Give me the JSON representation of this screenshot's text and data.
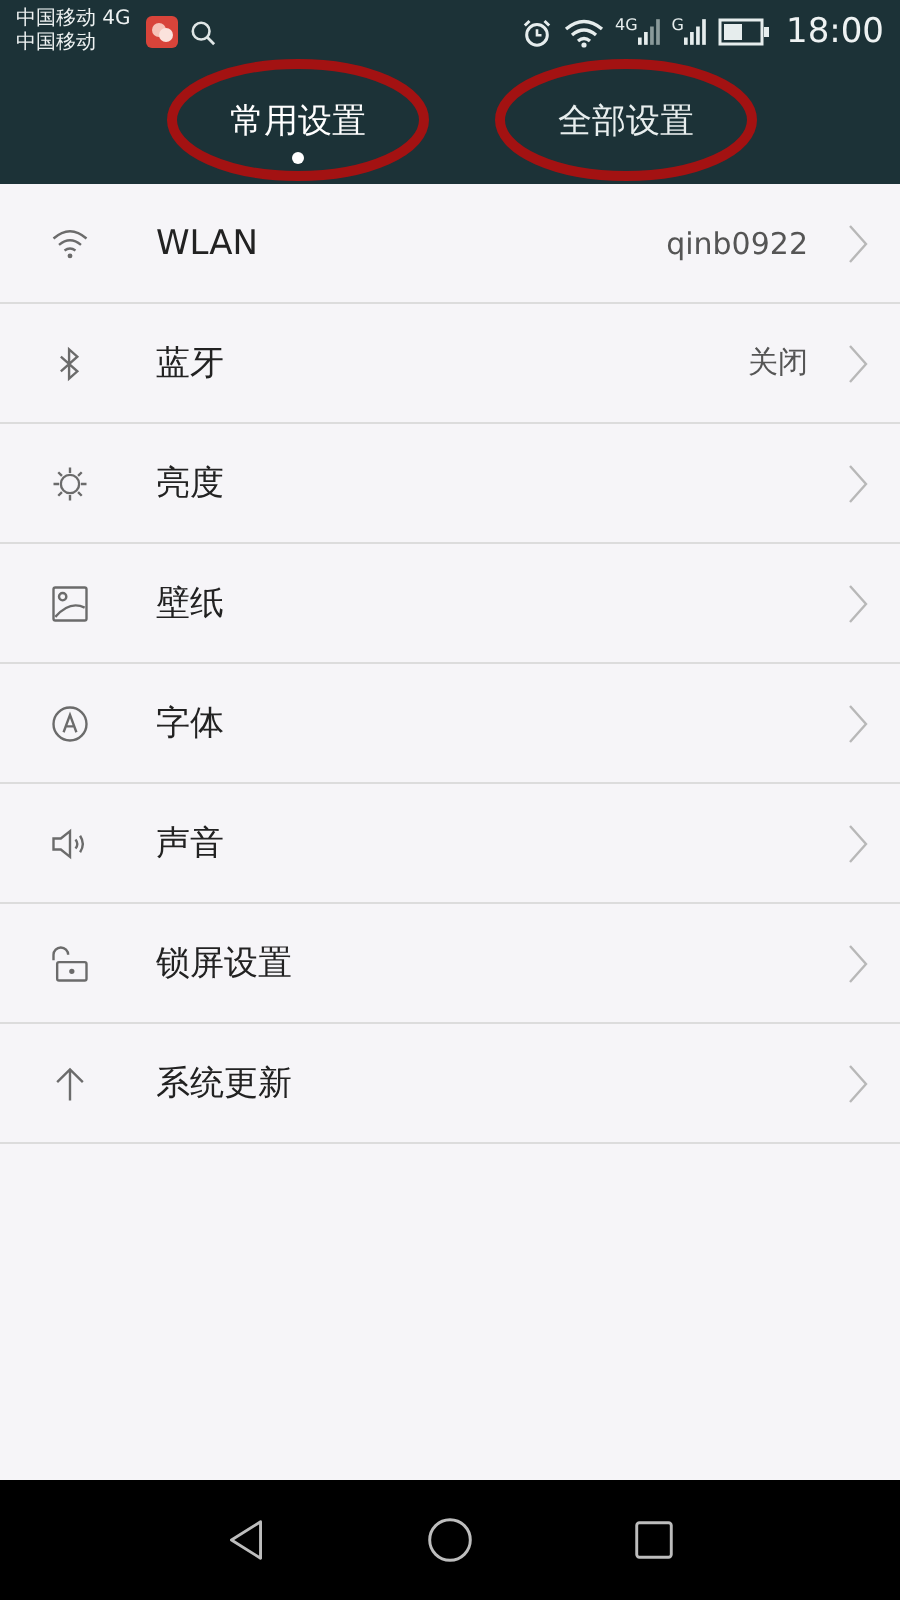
{
  "status_bar": {
    "carrier_1": "中国移动 4G",
    "carrier_2": "中国移动",
    "signal_1_label": "4G",
    "signal_2_label": "G",
    "time": "18:00"
  },
  "tabs": [
    {
      "label": "常用设置",
      "selected": true,
      "circled": true
    },
    {
      "label": "全部设置",
      "selected": false,
      "circled": true
    }
  ],
  "settings": [
    {
      "kind": "wifi",
      "label": "WLAN",
      "value": "qinb0922"
    },
    {
      "kind": "bluetooth",
      "label": "蓝牙",
      "value": "关闭"
    },
    {
      "kind": "brightness",
      "label": "亮度"
    },
    {
      "kind": "wallpaper",
      "label": "壁纸"
    },
    {
      "kind": "font",
      "label": "字体"
    },
    {
      "kind": "sound",
      "label": "声音"
    },
    {
      "kind": "lock",
      "label": "锁屏设置"
    },
    {
      "kind": "update",
      "label": "系统更新"
    }
  ]
}
